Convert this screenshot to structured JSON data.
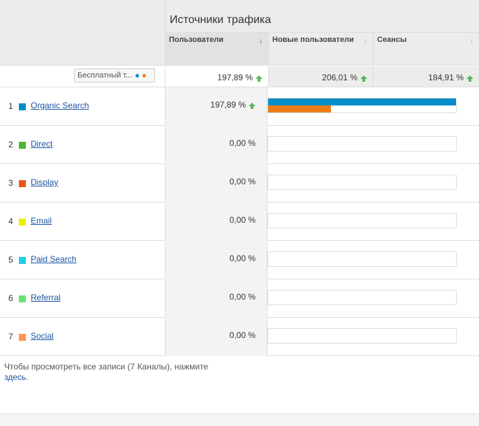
{
  "table": {
    "group_title": "Источники трафика",
    "columns": [
      {
        "label": "Пользователи",
        "sort_icon": "↓",
        "active": true
      },
      {
        "label": "Новые пользователи",
        "sort_icon": "↓",
        "active": false
      },
      {
        "label": "Сеансы",
        "sort_icon": "↓",
        "active": false
      }
    ],
    "segment": {
      "label": "Бесплатный т...",
      "dot_colors": [
        "#058dc7",
        "#ed7e17"
      ]
    },
    "totals": [
      "197,89 %",
      "206,01 %",
      "184,91 %"
    ],
    "rows": [
      {
        "index": "1",
        "channel": "Organic Search",
        "color": "#058dc7",
        "value": "197,89 %",
        "up": true,
        "bar_current": 1.0,
        "bar_previous": 0.336
      },
      {
        "index": "2",
        "channel": "Direct",
        "color": "#50b432",
        "value": "0,00 %",
        "up": false,
        "bar_current": 0,
        "bar_previous": 0
      },
      {
        "index": "3",
        "channel": "Display",
        "color": "#ed561b",
        "value": "0,00 %",
        "up": false,
        "bar_current": 0,
        "bar_previous": 0
      },
      {
        "index": "4",
        "channel": "Email",
        "color": "#edef00",
        "value": "0,00 %",
        "up": false,
        "bar_current": 0,
        "bar_previous": 0
      },
      {
        "index": "5",
        "channel": "Paid Search",
        "color": "#24cbe5",
        "value": "0,00 %",
        "up": false,
        "bar_current": 0,
        "bar_previous": 0
      },
      {
        "index": "6",
        "channel": "Referral",
        "color": "#64e572",
        "value": "0,00 %",
        "up": false,
        "bar_current": 0,
        "bar_previous": 0
      },
      {
        "index": "7",
        "channel": "Social",
        "color": "#ff9655",
        "value": "0,00 %",
        "up": false,
        "bar_current": 0,
        "bar_previous": 0
      }
    ],
    "bar_colors": {
      "current": "#058dc7",
      "previous": "#ed7e17"
    }
  },
  "footer": {
    "text": "Чтобы просмотреть все записи (7 Каналы), нажмите ",
    "link": "здесь",
    "end": "."
  }
}
